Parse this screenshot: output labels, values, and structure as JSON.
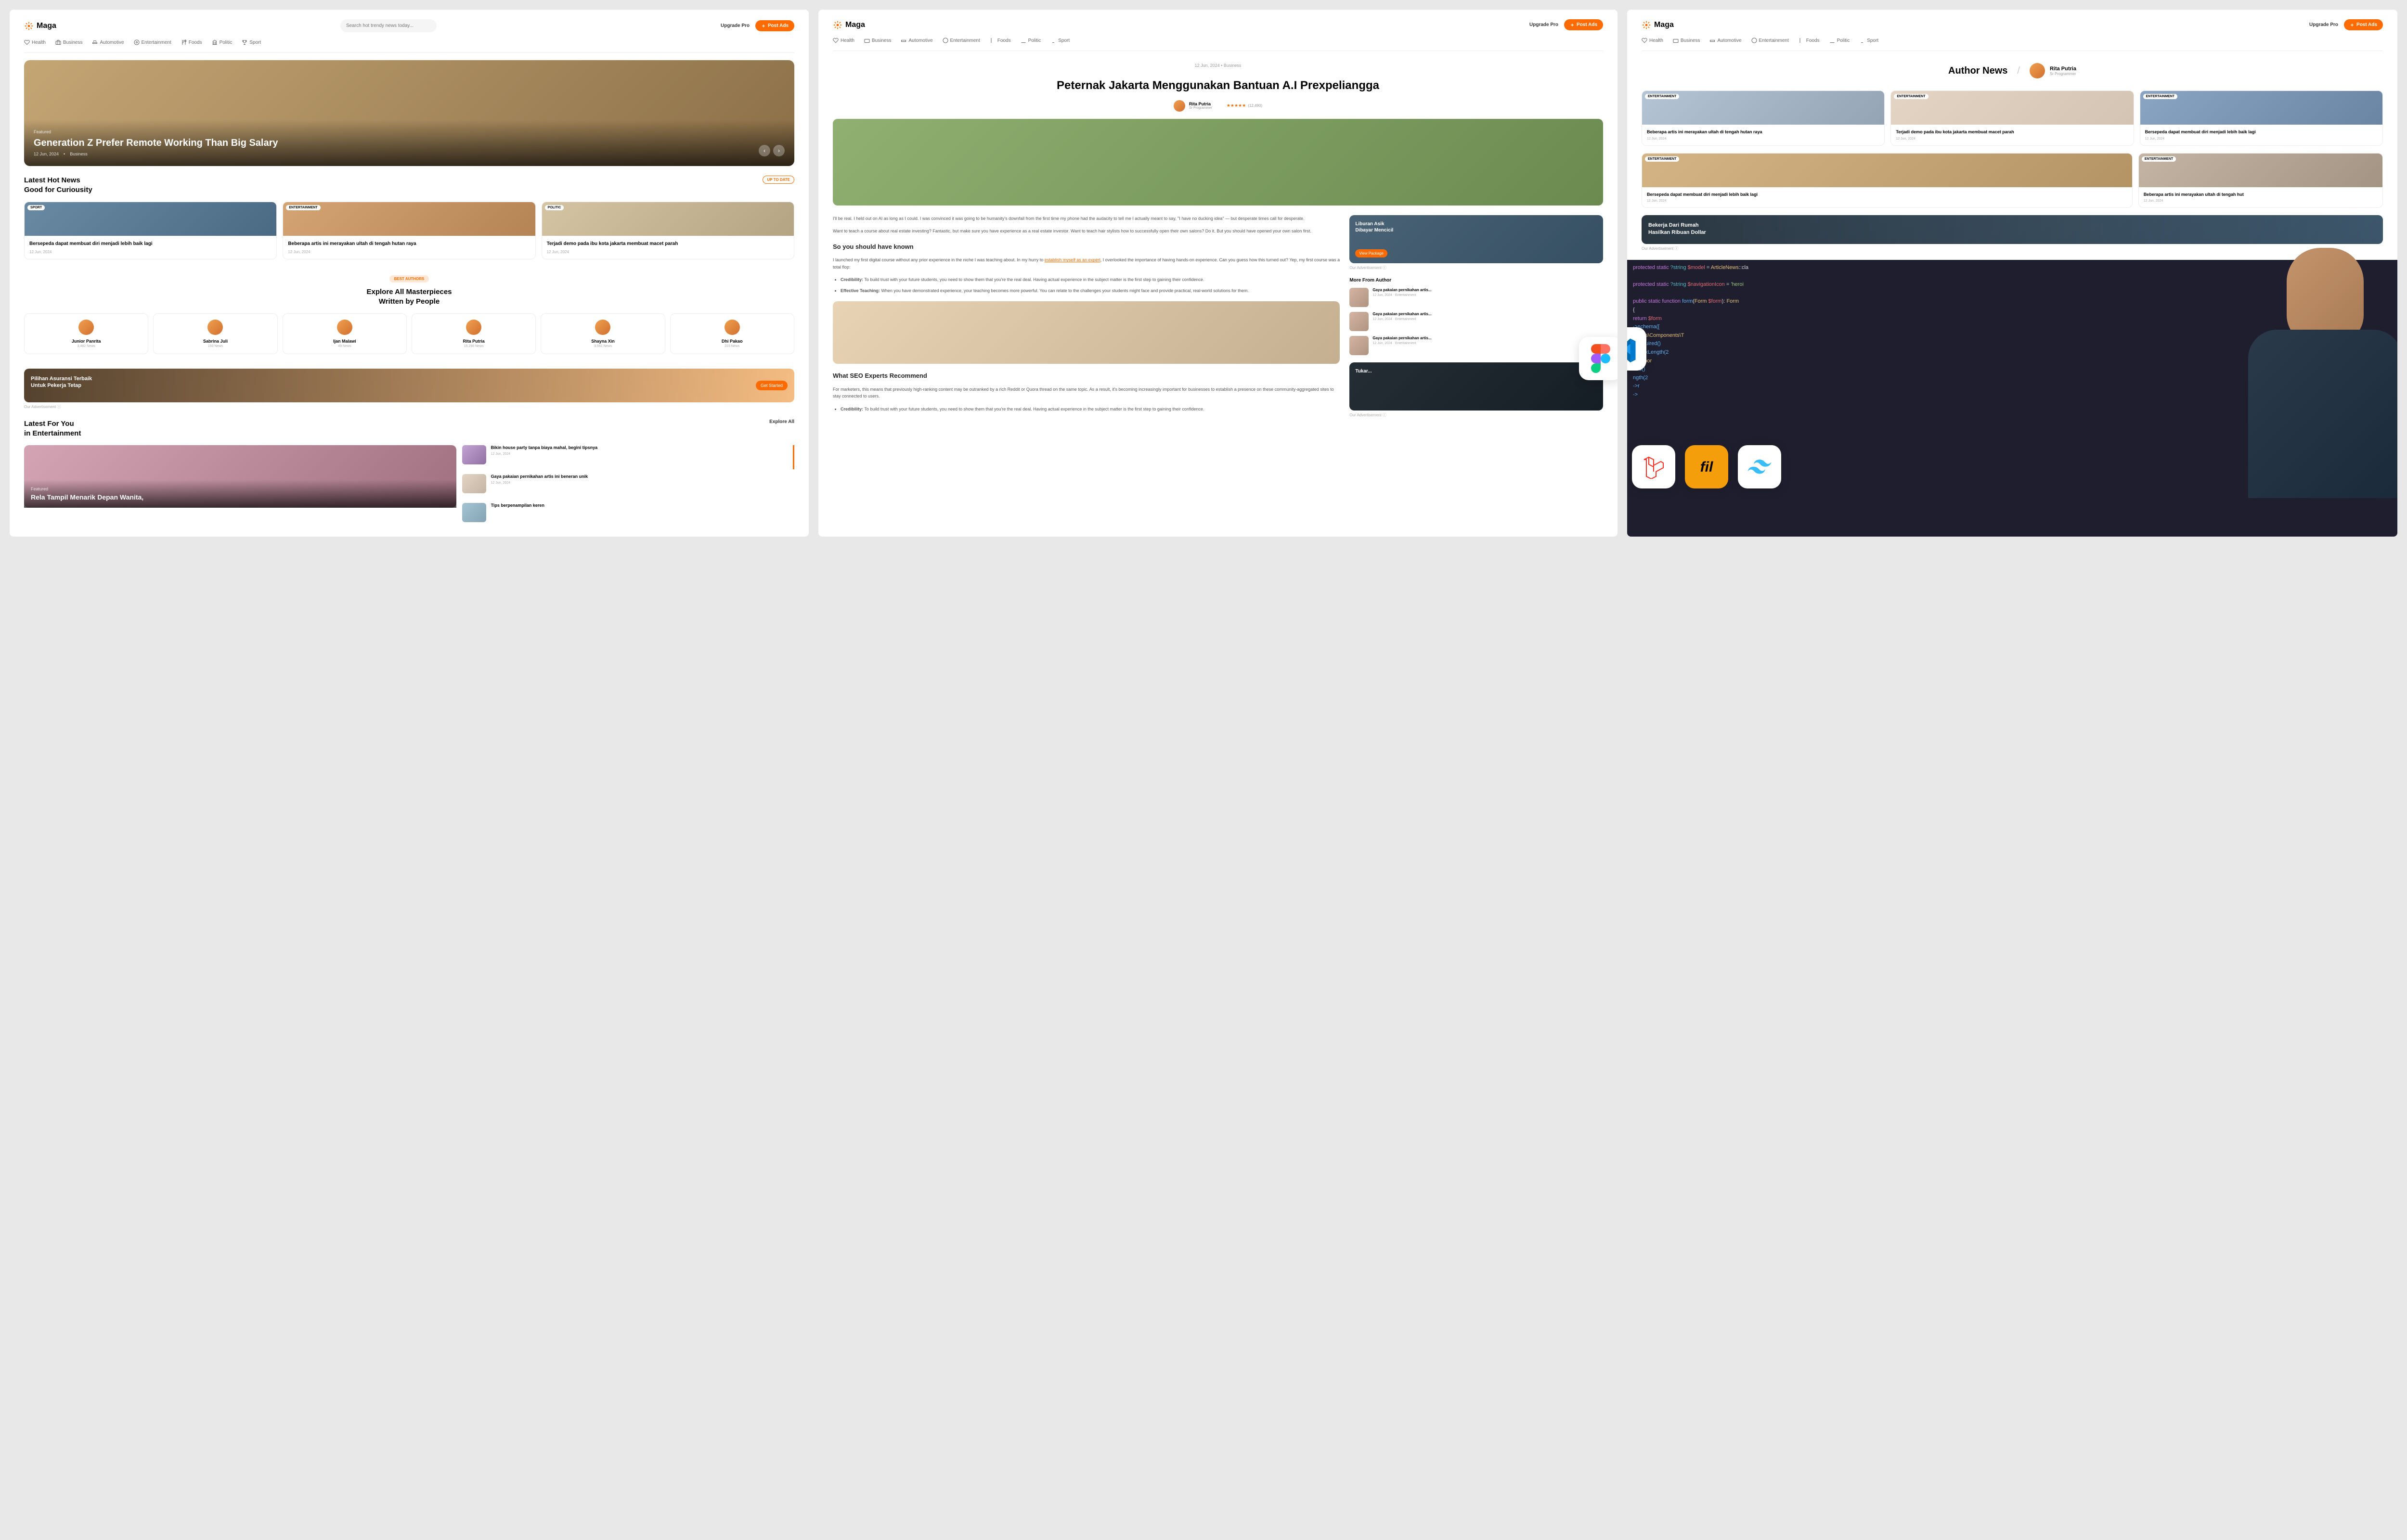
{
  "brand": "Maga",
  "header": {
    "search_placeholder": "Search hot trendy news today...",
    "upgrade": "Upgrade Pro",
    "post_ads": "Post Ads"
  },
  "nav": {
    "health": "Health",
    "business": "Business",
    "automotive": "Automotive",
    "entertainment": "Entertainment",
    "foods": "Foods",
    "politic": "Politic",
    "sport": "Sport"
  },
  "hero": {
    "featured": "Featured",
    "title": "Generation Z Prefer Remote Working Than Big Salary",
    "date": "12 Jun, 2024",
    "category": "Business"
  },
  "hot_news": {
    "title_line1": "Latest Hot News",
    "title_line2": "Good for Curiousity",
    "badge": "UP TO DATE",
    "items": [
      {
        "cat": "SPORT",
        "title": "Bersepeda dapat membuat diri menjadi lebih baik lagi",
        "date": "12 Jun, 2024"
      },
      {
        "cat": "ENTERTAINMENT",
        "title": "Beberapa artis ini merayakan ultah di tengah hutan raya",
        "date": "12 Jun, 2024"
      },
      {
        "cat": "POLITIC",
        "title": "Terjadi demo pada ibu kota jakarta membuat macet parah",
        "date": "12 Jun, 2024"
      }
    ]
  },
  "authors": {
    "badge": "BEST AUTHORS",
    "title_line1": "Explore All Masterpieces",
    "title_line2": "Written by People",
    "list": [
      {
        "name": "Junior Panrita",
        "count": "3,482 News"
      },
      {
        "name": "Sabrina Juli",
        "count": "193 News"
      },
      {
        "name": "Ijan Malawi",
        "count": "49 News"
      },
      {
        "name": "Rita Putria",
        "count": "15,296 News"
      },
      {
        "name": "Shayna Xin",
        "count": "3,552 News"
      },
      {
        "name": "Dhi Pakao",
        "count": "223 News"
      }
    ]
  },
  "promo1": {
    "title_line1": "Pilihan Asuransi Terbaik",
    "title_line2": "Untuk Pekerja Tetap",
    "btn": "Get Started",
    "ad_label": "Our Advertisement ⓘ"
  },
  "latest": {
    "title_line1": "Latest For You",
    "title_line2": "in Entertainment",
    "explore": "Explore All",
    "main": {
      "featured": "Featured",
      "title": "Rela Tampil Menarik Depan Wanita,"
    },
    "side": [
      {
        "title": "Bikin house party tanpa biaya mahal, begini tipsnya",
        "date": "12 Jun, 2024"
      },
      {
        "title": "Gaya pakaian pernikahan artis ini beneran unik",
        "date": "12 Jun, 2024"
      },
      {
        "title": "Tips berpenampilan keren"
      }
    ]
  },
  "article": {
    "date": "12 Jun, 2024",
    "category": "Business",
    "title": "Peternak Jakarta Menggunakan Bantuan A.I Prexpeliangga",
    "author_name": "Rita Putria",
    "author_role": "Sr Programmer",
    "rating_count": "(12,490)",
    "p1": "I'll be real. I held out on AI as long as I could. I was convinced it was going to be humanity's downfall from the first time my phone had the audacity to tell me I actually meant to say, \"I have no ducking idea\" — but desperate times call for desperate.",
    "p2": "Want to teach a course about real estate investing? Fantastic, but make sure you have experience as a real estate investor. Want to teach hair stylists how to successfully open their own salons? Do it. But you should have opened your own salon first.",
    "h1": "So you should have known",
    "p3_a": "I launched my first digital course without any prior experience in the niche I was teaching about. In my hurry to ",
    "p3_link": "establish myself as an expert",
    "p3_b": ", I overlooked the importance of having hands-on experience. Can you guess how this turned out? Yep, my first course was a total flop:",
    "li1_label": "Credibility:",
    "li1": " To build trust with your future students, you need to show them that you're the real deal. Having actual experience in the subject matter is the first step to gaining their confidence.",
    "li2_label": "Effective Teaching:",
    "li2": " When you have demonstrated experience, your teaching becomes more powerful. You can relate to the challenges your students might face and provide practical, real-world solutions for them.",
    "h2": "What SEO Experts Recommend",
    "p4": "For marketers, this means that previously high-ranking content may be outranked by a rich Reddit or Quora thread on the same topic. As a result, it's becoming increasingly important for businesses to establish a presence on these community-aggregated sites to stay connected to users.",
    "li3_label": "Credibility:",
    "li3": " To build trust with your future students, you need to show them that you're the real deal. Having actual experience in the subject matter is the first step to gaining their confidence."
  },
  "side_promo": {
    "title_line1": "Liburan Asik",
    "title_line2": "Dibayar Mencicil",
    "btn": "View Package",
    "ad_label": "Our Advertisement ⓘ"
  },
  "more_author": {
    "title": "More From Author",
    "items": [
      {
        "title": "Gaya pakaian pernikahan artis...",
        "date": "12 Jun, 2024 · Entertainment"
      },
      {
        "title": "Gaya pakaian pernikahan artis...",
        "date": "12 Jun, 2024 · Entertainment"
      },
      {
        "title": "Gaya pakaian pernikahan artis...",
        "date": "12 Jun, 2024 · Entertainment"
      }
    ]
  },
  "side_promo2": {
    "title": "Tukar...",
    "ad_label": "Our Advertisement ⓘ"
  },
  "author_page": {
    "title": "Author News",
    "name": "Rita Putria",
    "role": "Sr Programmer",
    "row1": [
      {
        "cat": "ENTERTAINMENT",
        "title": "Beberapa artis ini merayakan ultah di tengah hutan raya",
        "date": "12 Jun, 2024"
      },
      {
        "cat": "ENTERTAINMENT",
        "title": "Terjadi demo pada ibu kota jakarta membuat macet parah",
        "date": "12 Jun, 2024"
      },
      {
        "cat": "ENTERTAINMENT",
        "title": "Bersepeda dapat membuat diri menjadi lebih baik lagi",
        "date": "12 Jun, 2024"
      }
    ],
    "row2": [
      {
        "cat": "ENTERTAINMENT",
        "title": "Bersepeda dapat membuat diri menjadi lebih baik lagi",
        "date": "12 Jun, 2024"
      },
      {
        "cat": "ENTERTAINMENT",
        "title": "Beberapa artis ini merayakan ultah di tengah hut",
        "date": "12 Jun, 2024"
      }
    ],
    "promo_line1": "Bekerja Dari Rumah",
    "promo_line2": "Hasilkan Ribuan Dollar",
    "ad_label": "Our Advertisement ⓘ"
  },
  "code": {
    "l1a": "protected static ",
    "l1b": "?string ",
    "l1c": "$model",
    "l1d": " = ",
    "l1e": "ArticleNews",
    "l1f": "::cla",
    "l2a": "protected static ",
    "l2b": "?string ",
    "l2c": "$navigationIcon",
    "l2d": " = ",
    "l2e": "'heroi",
    "l3a": "public static function ",
    "l3b": "form",
    "l3c": "(",
    "l3d": "Form ",
    "l3e": "$form",
    "l3f": "): ",
    "l3g": "Form",
    "l4": "{",
    "l5a": "    return ",
    "l5b": "$form",
    "l6": "        ->schema([",
    "l7a": "            Forms\\Components\\T",
    "l8": "            ->required()",
    "l9": "            ->maxLength(2",
    "l10": "            Compor",
    "l11": "            ired()",
    "l12": "            ngth(2",
    "l13": "            ->r",
    "l14": "            ->"
  }
}
